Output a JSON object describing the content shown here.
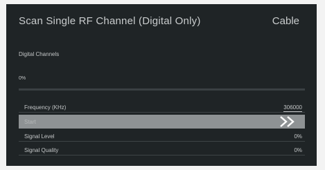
{
  "screen": {
    "title": "Scan Single RF Channel  (Digital Only)",
    "input_source": "Cable"
  },
  "digital_channels": {
    "label": "Digital Channels",
    "progress_text": "0%",
    "progress": 0
  },
  "settings": {
    "frequency_label": "Frequency (KHz)",
    "frequency_value": "306000",
    "start_label": "Start",
    "start_icon": "double-chevron-right-icon",
    "signal_level_label": "Signal Level",
    "signal_level_value": "0%",
    "signal_quality_label": "Signal Quality",
    "signal_quality_value": "0%"
  },
  "colors": {
    "background": "#1f2426",
    "highlight": "#8e9294",
    "text": "#c9cccd"
  }
}
